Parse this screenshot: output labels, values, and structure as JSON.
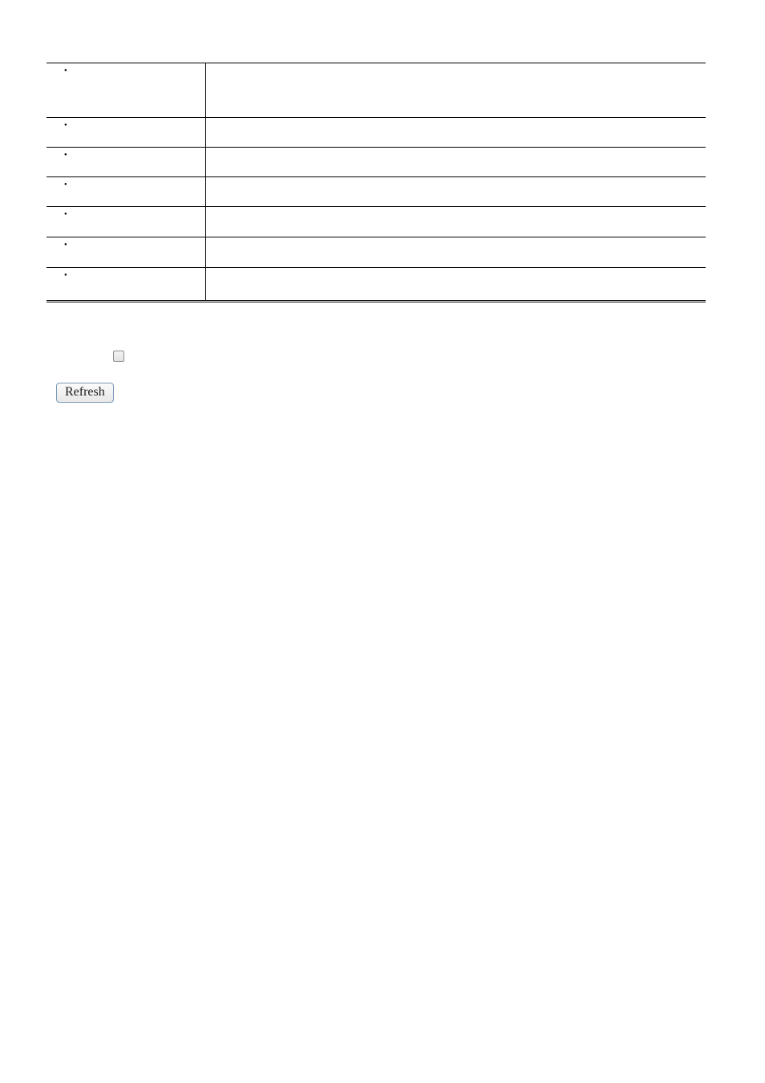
{
  "rows": [
    {
      "label": "",
      "value": ""
    },
    {
      "label": "",
      "value": ""
    },
    {
      "label": "",
      "value": ""
    },
    {
      "label": "",
      "value": ""
    },
    {
      "label": "",
      "value": ""
    },
    {
      "label": "",
      "value": ""
    },
    {
      "label": "",
      "value": ""
    }
  ],
  "controls": {
    "checkbox_checked": false,
    "refresh_label": "Refresh"
  }
}
